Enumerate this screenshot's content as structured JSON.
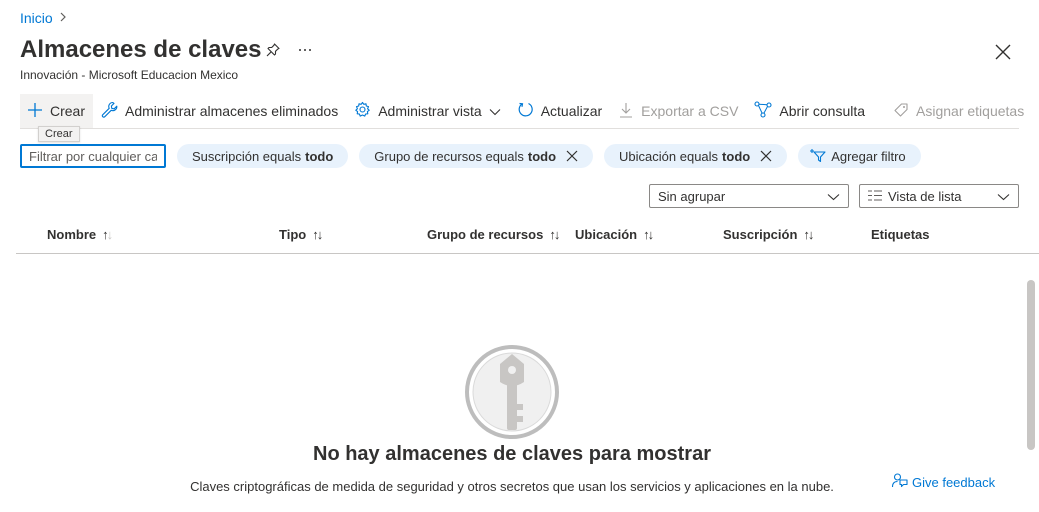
{
  "breadcrumb": {
    "home": "Inicio"
  },
  "page": {
    "title": "Almacenes de claves",
    "subtitle": "Innovación - Microsoft Educacion Mexico",
    "pin_icon": "pin-icon",
    "more_icon": "ellipsis-icon",
    "close_icon": "close-icon"
  },
  "toolbar": {
    "create": "Crear",
    "manage_deleted": "Administrar almacenes eliminados",
    "manage_view": "Administrar vista",
    "refresh": "Actualizar",
    "export_csv": "Exportar a CSV",
    "open_query": "Abrir consulta",
    "assign_tags": "Asignar etiquetas"
  },
  "tooltip": {
    "text": "Crear"
  },
  "filters": {
    "placeholder": "Filtrar por cualquier ca",
    "pills": [
      {
        "label": "Suscripción equals",
        "value": "todo"
      },
      {
        "label": "Grupo de recursos equals",
        "value": "todo"
      },
      {
        "label": "Ubicación equals",
        "value": "todo"
      }
    ],
    "add_filter": "Agregar filtro"
  },
  "grouping": {
    "selected": "Sin agrupar"
  },
  "view": {
    "selected": "Vista de lista"
  },
  "table": {
    "columns": [
      "Nombre",
      "Tipo",
      "Grupo de recursos",
      "Ubicación",
      "Suscripción",
      "Etiquetas"
    ]
  },
  "empty_state": {
    "title": "No hay almacenes de claves para mostrar",
    "description": "Claves criptográficas de medida de seguridad y otros secretos que usan los servicios y aplicaciones en la nube.",
    "icon": "key-icon"
  },
  "feedback": {
    "label": "Give feedback"
  },
  "colors": {
    "accent": "#0078d4",
    "pill_bg": "#e8f2fc",
    "text": "#323130",
    "disabled": "#a19f9d"
  }
}
